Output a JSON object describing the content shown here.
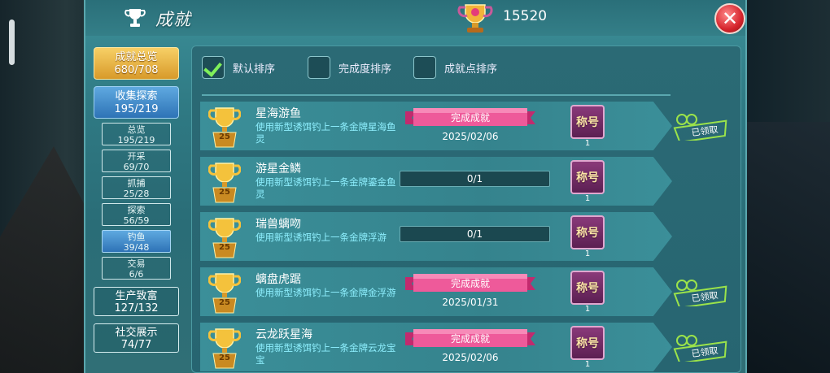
{
  "window": {
    "title": "成就",
    "score": "15520"
  },
  "nav": {
    "total": {
      "label": "成就总览",
      "count": "680/708"
    },
    "collect": {
      "label": "收集探索",
      "count": "195/219"
    },
    "subs": [
      {
        "label": "总览",
        "count": "195/219"
      },
      {
        "label": "开采",
        "count": "69/70"
      },
      {
        "label": "抓捕",
        "count": "25/28"
      },
      {
        "label": "探索",
        "count": "56/59"
      },
      {
        "label": "钓鱼",
        "count": "39/48"
      },
      {
        "label": "交易",
        "count": "6/6"
      }
    ],
    "production": {
      "label": "生产致富",
      "count": "127/132"
    },
    "social": {
      "label": "社交展示",
      "count": "74/77"
    }
  },
  "sort": {
    "default": "默认排序",
    "completion": "完成度排序",
    "points": "成就点排序"
  },
  "rows": [
    {
      "name": "星海游鱼",
      "points": "25",
      "desc": "使用新型诱饵钓上一条金牌星海鱼灵",
      "status": "完成成就",
      "date": "2025/02/06",
      "badge": "称号",
      "badge_count": "1",
      "claimed": "已领取"
    },
    {
      "name": "游星金鳞",
      "points": "25",
      "desc": "使用新型诱饵钓上一条金牌鎏金鱼灵",
      "progress": "0/1",
      "badge": "称号",
      "badge_count": "1"
    },
    {
      "name": "瑞兽螭吻",
      "points": "25",
      "desc": "使用新型诱饵钓上一条金牌浮游",
      "progress": "0/1",
      "badge": "称号",
      "badge_count": "1"
    },
    {
      "name": "螭盘虎踞",
      "points": "25",
      "desc": "使用新型诱饵钓上一条金牌金浮游",
      "status": "完成成就",
      "date": "2025/01/31",
      "badge": "称号",
      "badge_count": "1",
      "claimed": "已领取"
    },
    {
      "name": "云龙跃星海",
      "points": "25",
      "desc": "使用新型诱饵钓上一条金牌云龙宝宝",
      "status": "完成成就",
      "date": "2025/02/06",
      "badge": "称号",
      "badge_count": "1",
      "claimed": "已领取"
    }
  ],
  "colors": {
    "accent_gold": "#d89a2a",
    "accent_blue": "#2e73b6",
    "panel": "#2f7983",
    "check": "#7ff05a"
  },
  "icons": {
    "title": "trophy-icon",
    "score": "gold-trophy-icon",
    "close": "close-icon"
  }
}
